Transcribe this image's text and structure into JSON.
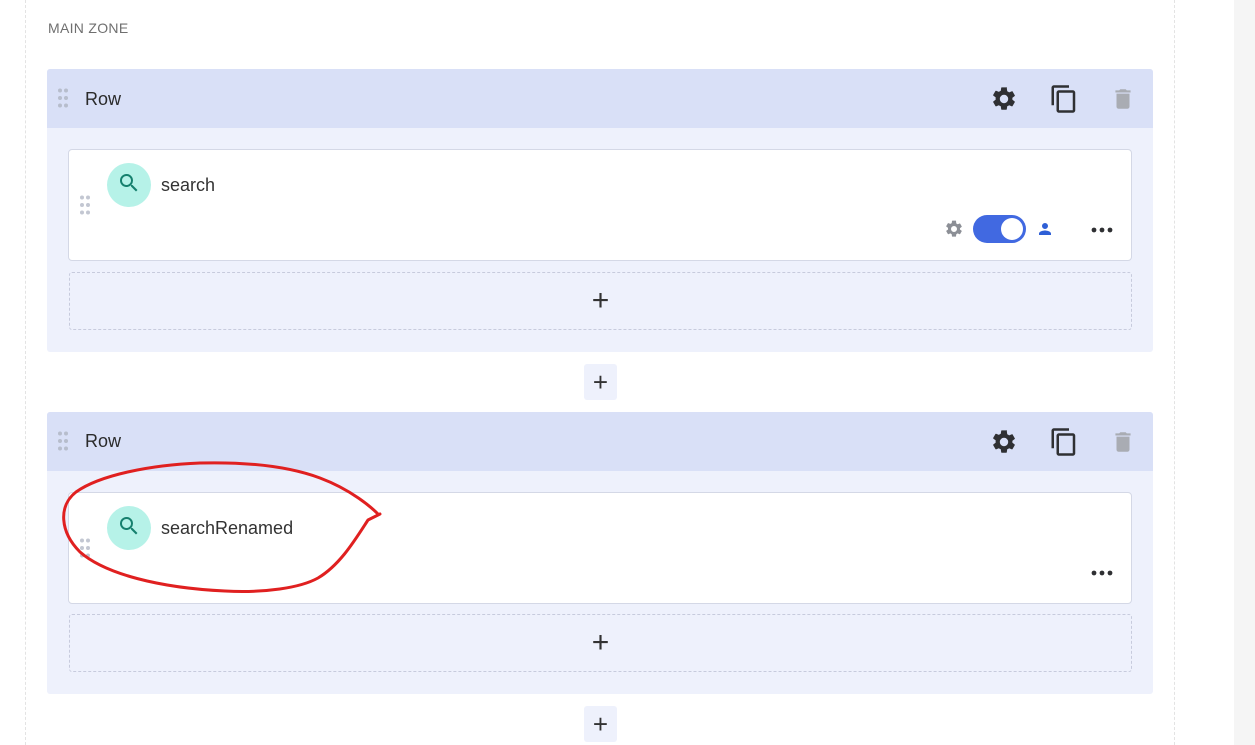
{
  "zone": {
    "title": "MAIN ZONE"
  },
  "rows": [
    {
      "title": "Row",
      "widget": {
        "name": "search",
        "icon": "search-icon",
        "visibility_enabled": true
      },
      "add_widget_symbol": "+"
    },
    {
      "title": "Row",
      "widget": {
        "name": "searchRenamed",
        "icon": "search-icon"
      },
      "add_widget_symbol": "+"
    }
  ],
  "add_row_symbol": "+",
  "colors": {
    "accent": "#4169e1",
    "row_header": "#d9e0f7",
    "row_body": "#eef1fc",
    "avatar": "#b6f2e8",
    "annotation": "#e02020"
  }
}
